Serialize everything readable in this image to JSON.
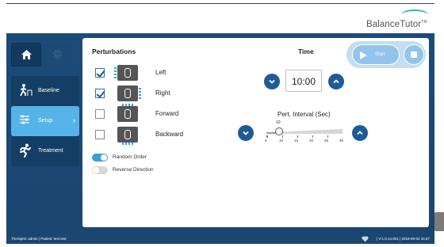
{
  "brand": {
    "name": "BalanceTutor",
    "trademark": "TM"
  },
  "nav": {
    "items": [
      {
        "label": "Baseline",
        "icon": "baseline-walker-icon"
      },
      {
        "label": "Setup",
        "icon": "setup-sliders-icon"
      },
      {
        "label": "Treatment",
        "icon": "treatment-runner-icon"
      }
    ],
    "home_icon": "home-icon",
    "settings_icon": "gear-icon"
  },
  "perturbations": {
    "title": "Perturbations",
    "items": [
      {
        "label": "Left",
        "checked": true
      },
      {
        "label": "Right",
        "checked": true
      },
      {
        "label": "Forward",
        "checked": false
      },
      {
        "label": "Backward",
        "checked": false
      }
    ],
    "random_order": {
      "label": "Random Order",
      "on": true
    },
    "reverse_direction": {
      "label": "Reverse Direction",
      "on": false
    }
  },
  "time": {
    "title": "Time",
    "value": "10:00"
  },
  "controls": {
    "start_label": "Start"
  },
  "interval": {
    "title": "Pert. Interval (Sec)",
    "value": "10",
    "min": 5,
    "max": 30,
    "ticks": [
      "5",
      "10",
      "15",
      "20",
      "25",
      "30"
    ]
  },
  "status": {
    "left": "Therapist: admin  |  Patient: test test",
    "right": "|  V:1.0.14.801  |  2018-09-02 16:57"
  },
  "colors": {
    "accent": "#1f5b96",
    "nav_active": "#55b3e8",
    "app_bg": "#1f4f7d"
  }
}
